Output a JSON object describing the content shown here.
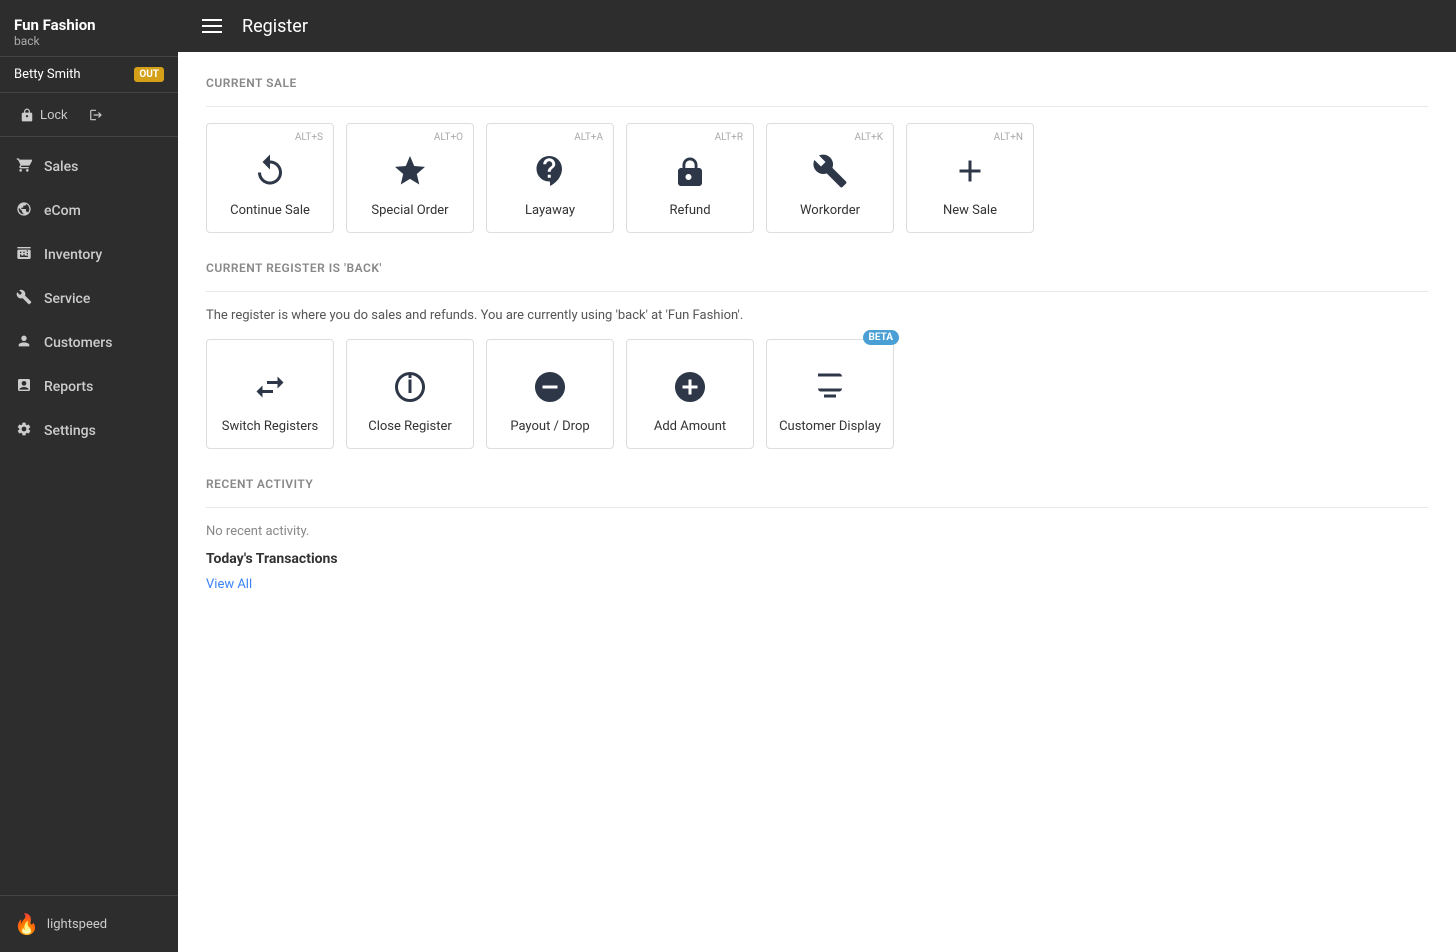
{
  "brand": {
    "name": "Fun Fashion",
    "register": "back"
  },
  "user": {
    "name": "Betty Smith",
    "status": "OUT"
  },
  "sidebar": {
    "lock_label": "Lock",
    "logout_label": "",
    "nav_items": [
      {
        "id": "sales",
        "label": "Sales",
        "icon": "cart"
      },
      {
        "id": "ecom",
        "label": "eCom",
        "icon": "globe"
      },
      {
        "id": "inventory",
        "label": "Inventory",
        "icon": "box"
      },
      {
        "id": "service",
        "label": "Service",
        "icon": "wrench"
      },
      {
        "id": "customers",
        "label": "Customers",
        "icon": "person"
      },
      {
        "id": "reports",
        "label": "Reports",
        "icon": "chart"
      },
      {
        "id": "settings",
        "label": "Settings",
        "icon": "gear"
      }
    ],
    "logo_text": "lightspeed"
  },
  "topbar": {
    "title": "Register"
  },
  "current_sale": {
    "section_title": "CURRENT SALE",
    "cards": [
      {
        "id": "continue-sale",
        "label": "Continue Sale",
        "shortcut": "ALT+S",
        "icon": "redo"
      },
      {
        "id": "special-order",
        "label": "Special Order",
        "shortcut": "ALT+O",
        "icon": "star"
      },
      {
        "id": "layaway",
        "label": "Layaway",
        "shortcut": "ALT+A",
        "icon": "umbrella"
      },
      {
        "id": "refund",
        "label": "Refund",
        "shortcut": "ALT+R",
        "icon": "ticket"
      },
      {
        "id": "workorder",
        "label": "Workorder",
        "shortcut": "ALT+K",
        "icon": "wrench2"
      },
      {
        "id": "new-sale",
        "label": "New Sale",
        "shortcut": "ALT+N",
        "icon": "plus"
      }
    ]
  },
  "register_section": {
    "section_title": "CURRENT REGISTER IS 'BACK'",
    "info_text": "The register is where you do sales and refunds. You are currently using 'back'  at 'Fun Fashion'.",
    "cards": [
      {
        "id": "switch-registers",
        "label": "Switch Registers",
        "icon": "switch",
        "beta": false
      },
      {
        "id": "close-register",
        "label": "Close Register",
        "icon": "power",
        "beta": false
      },
      {
        "id": "payout-drop",
        "label": "Payout / Drop",
        "icon": "minus-circle",
        "beta": false
      },
      {
        "id": "add-amount",
        "label": "Add Amount",
        "icon": "plus-circle",
        "beta": false
      },
      {
        "id": "customer-display",
        "label": "Customer Display",
        "icon": "display",
        "beta": true
      }
    ]
  },
  "recent_activity": {
    "section_title": "RECENT ACTIVITY",
    "no_activity_text": "No recent activity.",
    "transactions_title": "Today's Transactions",
    "view_all_label": "View All"
  }
}
